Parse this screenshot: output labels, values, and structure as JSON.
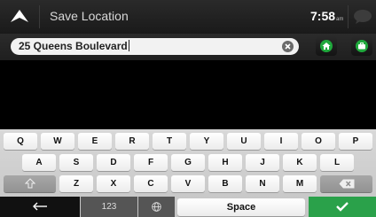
{
  "header": {
    "title": "Save Location",
    "time": "7:58",
    "ampm": "am",
    "back_icon": "up-arrow-icon",
    "message_icon": "speech-bubble-icon"
  },
  "search": {
    "value": "25 Queens Boulevard",
    "clear_icon": "clear-x-icon"
  },
  "shortcuts": {
    "home_icon": "home-icon",
    "work_icon": "briefcase-icon",
    "accent_color": "#1fa83c"
  },
  "keyboard": {
    "row1": [
      "Q",
      "W",
      "E",
      "R",
      "T",
      "Y",
      "U",
      "I",
      "O",
      "P"
    ],
    "row2": [
      "A",
      "S",
      "D",
      "F",
      "G",
      "H",
      "J",
      "K",
      "L"
    ],
    "row3": [
      "Z",
      "X",
      "C",
      "V",
      "B",
      "N",
      "M"
    ],
    "shift_icon": "shift-up-arrow-icon",
    "backspace_icon": "backspace-icon",
    "back_icon": "left-arrow-icon",
    "numbers_label": "123",
    "globe_icon": "globe-icon",
    "space_label": "Space",
    "done_icon": "checkmark-icon",
    "done_color": "#2aa14a"
  }
}
